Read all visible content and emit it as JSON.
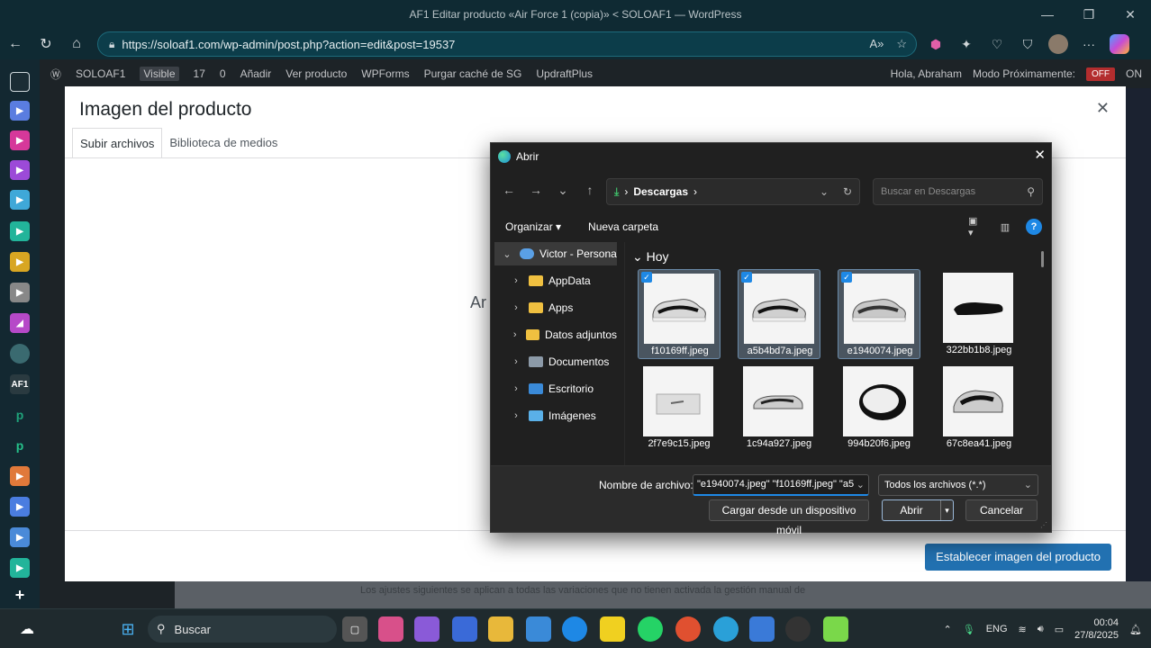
{
  "browser": {
    "window_title": "AF1  Editar producto «Air Force 1 (copia)» < SOLOAF1 — WordPress",
    "url": "https://soloaf1.com/wp-admin/post.php?action=edit&post=19537"
  },
  "wp_admin_bar": {
    "site": "SOLOAF1",
    "visible_badge": "Visible",
    "comments_count": "17",
    "pending_count": "0",
    "add_new": "Añadir",
    "view_product": "Ver producto",
    "wpforms": "WPForms",
    "purge_cache": "Purgar caché de SG",
    "updraft": "UpdraftPlus",
    "greeting": "Hola, Abraham",
    "coming_soon": "Modo Próximamente:",
    "off": "OFF",
    "on": "ON"
  },
  "media_modal": {
    "title": "Imagen del producto",
    "tab_upload": "Subir archivos",
    "tab_library": "Biblioteca de medios",
    "set_button": "Establecer imagen del producto",
    "bg_text": "Ar",
    "bg_notice": "Los ajustes siguientes se aplican a todas las variaciones que no tienen activada la gestión manual de"
  },
  "file_dialog": {
    "title": "Abrir",
    "path": "Descargas",
    "search_placeholder": "Buscar en Descargas",
    "organize": "Organizar",
    "new_folder": "Nueva carpeta",
    "tree": [
      {
        "label": "Victor - Persona",
        "expanded": true
      },
      {
        "label": "AppData"
      },
      {
        "label": "Apps"
      },
      {
        "label": "Datos adjuntos"
      },
      {
        "label": "Documentos"
      },
      {
        "label": "Escritorio"
      },
      {
        "label": "Imágenes"
      }
    ],
    "group_label": "Hoy",
    "files": [
      {
        "name": "f10169ff.jpeg",
        "selected": true
      },
      {
        "name": "a5b4bd7a.jpeg",
        "selected": true
      },
      {
        "name": "e1940074.jpeg",
        "selected": true
      },
      {
        "name": "322bb1b8.jpeg",
        "selected": false
      },
      {
        "name": "2f7e9c15.jpeg",
        "selected": false
      },
      {
        "name": "1c94a927.jpeg",
        "selected": false
      },
      {
        "name": "994b20f6.jpeg",
        "selected": false
      },
      {
        "name": "67c8ea41.jpeg",
        "selected": false
      }
    ],
    "filename_label": "Nombre de archivo:",
    "filename_value": "\"e1940074.jpeg\" \"f10169ff.jpeg\" \"a5",
    "filter": "Todos los archivos (*.*)",
    "upload_mobile": "Cargar desde un dispositivo móvil",
    "open": "Abrir",
    "cancel": "Cancelar"
  },
  "taskbar": {
    "search": "Buscar",
    "language": "ENG",
    "time": "00:04",
    "date": "27/8/2025"
  }
}
